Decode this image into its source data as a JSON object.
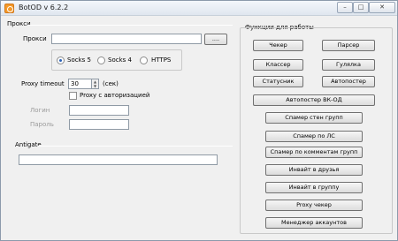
{
  "window": {
    "title": "BotOD   v 6.2.2",
    "minimize": "–",
    "maximize": "□",
    "close": "✕"
  },
  "proxy": {
    "section_title": "Прокси",
    "label": "Прокси",
    "value": "",
    "browse_label": "....",
    "radios": [
      {
        "label": "Socks 5",
        "checked": true
      },
      {
        "label": "Socks 4",
        "checked": false
      },
      {
        "label": "HTTPS",
        "checked": false
      }
    ],
    "timeout_label": "Proxy timeout",
    "timeout_value": "30",
    "timeout_unit": "(сек)",
    "auth_label": "Proxy с авторизацией",
    "login_label": "Логин",
    "password_label": "Пароль",
    "login_value": "",
    "password_value": ""
  },
  "antigate": {
    "section_title": "Antigate",
    "value": ""
  },
  "functions": {
    "section_title": "Функции для работы",
    "row_buttons": [
      "Чекер",
      "Парсер",
      "Классер",
      "Гулялка",
      "Статусник",
      "Автопостер"
    ],
    "wide_buttons": [
      "Автопостер ВК-ОД",
      "Спамер стен  групп",
      "Спамер по ЛС",
      "Спамер по комментам групп",
      "Инвайт в друзья",
      "Инвайт в группу",
      "Proxy чекер",
      "Менеджер аккаунтов"
    ]
  }
}
